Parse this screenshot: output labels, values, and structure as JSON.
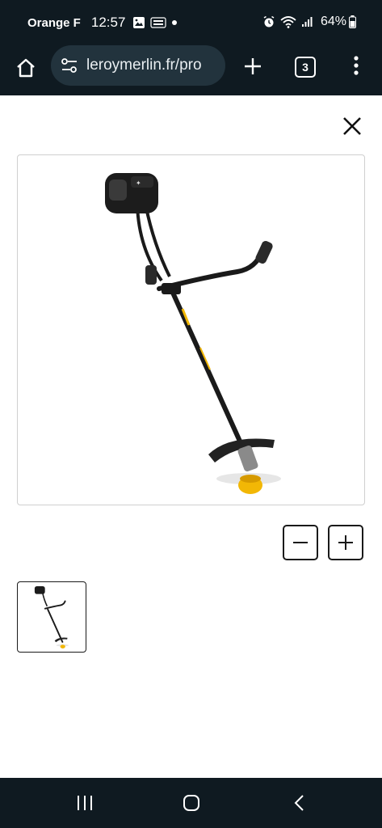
{
  "status_bar": {
    "carrier": "Orange F",
    "time": "12:57",
    "battery": "64%",
    "icons": [
      "gallery-icon",
      "temu-icon",
      "dot-icon",
      "alarm-icon",
      "wifi-icon",
      "signal-icon",
      "battery-icon"
    ]
  },
  "browser": {
    "url": "leroymerlin.fr/pro",
    "tab_count": "3",
    "icons": [
      "home-icon",
      "site-settings-icon",
      "new-tab-icon",
      "tabs-icon",
      "more-menu-icon"
    ]
  },
  "viewer": {
    "icons": [
      "close-icon",
      "zoom-out-icon",
      "zoom-in-icon"
    ],
    "main_image": "brush-cutter-image",
    "thumbnails": [
      "brush-cutter-thumbnail"
    ],
    "colors": {
      "frame": "#1a1a1a",
      "engine": "#1c1c1c",
      "accent": "#f2b705",
      "guard": "#222222"
    }
  },
  "nav_bar": {
    "icons": [
      "recents-icon",
      "home-button-icon",
      "back-icon"
    ]
  }
}
